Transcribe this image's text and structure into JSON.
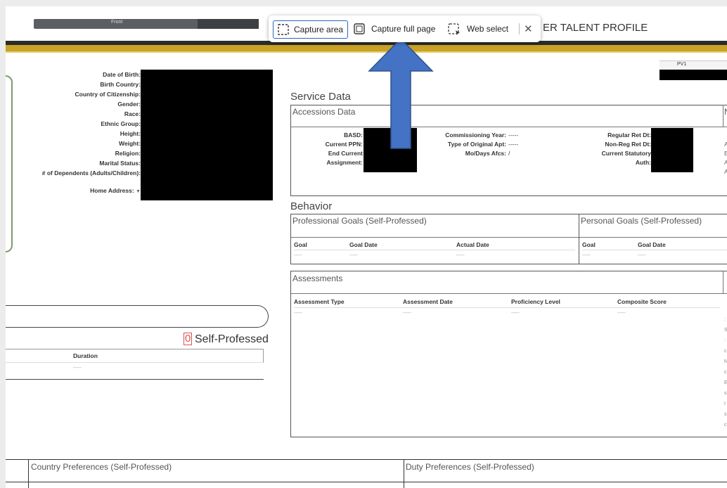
{
  "header": {
    "front_tab": "Front",
    "title_partial": "ER TALENT PROFILE",
    "pv_label": "PV1"
  },
  "personal": {
    "labels": [
      "Date of Birth:",
      "Birth Country:",
      "Country of Citizenship:",
      "Gender:",
      "Race:",
      "Ethnic Group:",
      "Height:",
      "Weight:",
      "Religion:",
      "Marital Status:",
      "# of Dependents (Adults/Children):"
    ],
    "home_address": "Home Address:"
  },
  "service": {
    "title": "Service Data",
    "accessions_title": "Accessions Data",
    "col1_labels": [
      "BASD:",
      "Current PPN:",
      "End Current",
      "Assignment:"
    ],
    "col2_labels": [
      "Commissioning Year:",
      "Type of Original Apt:",
      "Mo/Days Afcs:"
    ],
    "col2_values": [
      "-----",
      "-----",
      "/"
    ],
    "col3_labels": [
      "Regular Ret Dt:",
      "Non-Reg Ret Dt:",
      "Current Statutory",
      "Auth:"
    ],
    "right_partial": "N"
  },
  "behavior": {
    "title": "Behavior",
    "prof_goals_title": "Professional Goals (Self-Professed)",
    "pers_goals_title": "Personal Goals (Self-Professed)",
    "prof_headers": [
      "Goal",
      "Goal Date",
      "Actual Date"
    ],
    "pers_headers": [
      "Goal",
      "Goal Date"
    ],
    "empty": "-----"
  },
  "assessments": {
    "title": "Assessments",
    "headers": [
      "Assessment Type",
      "Assessment Date",
      "Proficiency Level",
      "Composite Score"
    ],
    "empty": "-----"
  },
  "left_lower": {
    "count": "0",
    "count_label": "Self-Professed",
    "duration_header": "Duration",
    "empty": "-----"
  },
  "bottom": {
    "country_prefs": "Country Preferences (Self-Professed)",
    "duty_prefs": "Duty Preferences (Self-Professed)"
  },
  "capture_toolbar": {
    "capture_area": "Capture area",
    "capture_full_page": "Capture full page",
    "web_select": "Web select",
    "close_symbol": "✕"
  },
  "colors": {
    "gold": "#c9a227",
    "annotation_arrow": "#4472c4",
    "toolbar_selected": "#2a67c2",
    "count_box": "#d9534f"
  }
}
